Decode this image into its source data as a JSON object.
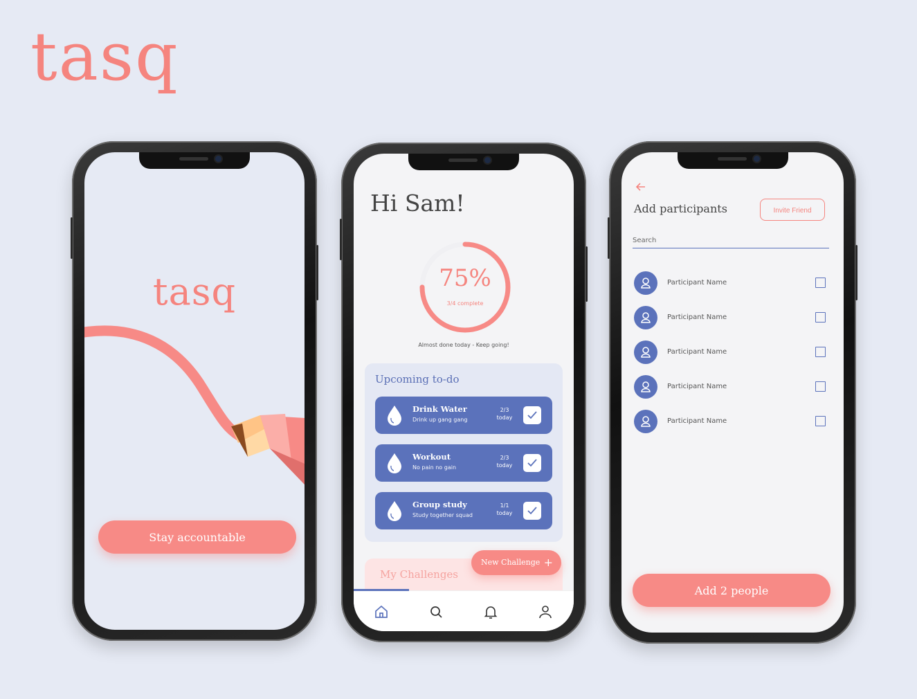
{
  "brand": {
    "logo_text": "tasq"
  },
  "colors": {
    "background": "#e6eaf4",
    "coral": "#f78a86",
    "brand_blue": "#5b72bb"
  },
  "splash": {
    "logo_text": "tasq",
    "cta_label": "Stay accountable"
  },
  "home": {
    "greeting": "Hi Sam!",
    "progress": {
      "percent_label": "75%",
      "fraction": 0.75,
      "sub_label": "3/4 complete",
      "message": "Almost done today - Keep going!"
    },
    "upcoming_title": "Upcoming to-do",
    "todos": [
      {
        "title": "Drink Water",
        "subtitle": "Drink up gang gang",
        "count": "2/3",
        "when": "today",
        "icon": "water-drop-icon"
      },
      {
        "title": "Workout",
        "subtitle": "No pain no gain",
        "count": "2/3",
        "when": "today",
        "icon": "water-drop-icon"
      },
      {
        "title": "Group study",
        "subtitle": "Study together squad",
        "count": "1/1",
        "when": "today",
        "icon": "water-drop-icon"
      }
    ],
    "challenges_title": "My Challenges",
    "new_challenge_label": "New Challenge",
    "new_challenge_icon": "plus-icon",
    "tabs": [
      "home-icon",
      "search-icon",
      "bell-icon",
      "user-icon"
    ]
  },
  "participants": {
    "title": "Add participants",
    "invite_label": "Invite Friend",
    "search_placeholder": "Search",
    "people": [
      {
        "name": "Participant Name"
      },
      {
        "name": "Participant Name"
      },
      {
        "name": "Participant Name"
      },
      {
        "name": "Participant Name"
      },
      {
        "name": "Participant Name"
      }
    ],
    "add_label": "Add 2 people"
  }
}
